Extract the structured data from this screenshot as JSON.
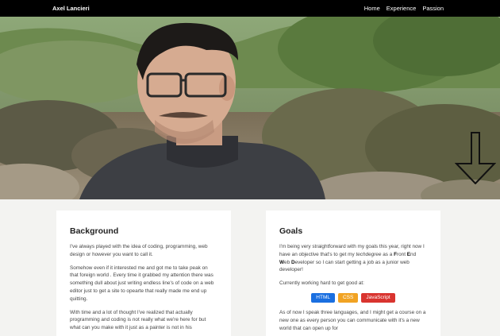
{
  "nav": {
    "brand": "Axel Lancieri",
    "links": [
      "Home",
      "Experience",
      "Passion"
    ]
  },
  "background_card": {
    "title": "Background",
    "p1": "I've always played with the idea of coding, programming, web design or however you want to call it.",
    "p2": "Somehow even if it interested me and got me to take peak on that foreign world . Every time it grabbed my attention there was something dull about just writing endless line's of code on a web editor just to get a site to opearte that really made me end up quitting.",
    "p3": "With time and a lot of thought I've realized that actually programming and coding is not really what we're here for but what can you make with it just as a painter is not in his"
  },
  "goals_card": {
    "title": "Goals",
    "p1_a": "I'm being very straightforward with my goals this year, right now I have an objective that's to get my ",
    "p1_em": "techdegree",
    "p1_b": " as a ",
    "p1_f": "F",
    "p1_front": "ront ",
    "p1_e": "E",
    "p1_end": "nd ",
    "p1_w": "W",
    "p1_web": "eb ",
    "p1_d": "D",
    "p1_dev": "eveloper so I can start getting a job as a junior web developer!",
    "p2": "Currently working hard to get good at:",
    "badges": [
      "HTML",
      "CSS",
      "JavaScript"
    ],
    "p3": "As of now I speak three languages, and I might get a course on a new one as every person you can communicate with it's a new world that can open up for"
  },
  "icons": {
    "scroll": "arrow-down-icon"
  }
}
